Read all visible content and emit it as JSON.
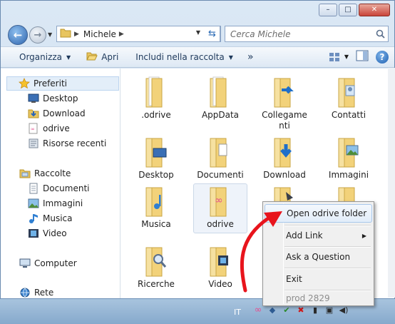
{
  "window": {
    "caption_buttons": {
      "minimize": "–",
      "maximize": "□",
      "close": "✕"
    }
  },
  "address_bar": {
    "breadcrumb": "Michele",
    "search_placeholder": "Cerca Michele"
  },
  "command_bar": {
    "organize": "Organizza",
    "open": "Apri",
    "include_library": "Includi nella raccolta",
    "more": "»"
  },
  "sidebar": {
    "favorites_header": "Preferiti",
    "favorites": [
      "Desktop",
      "Download",
      "odrive",
      "Risorse recenti"
    ],
    "libraries_header": "Raccolte",
    "libraries": [
      "Documenti",
      "Immagini",
      "Musica",
      "Video"
    ],
    "computer": "Computer",
    "network": "Rete"
  },
  "files": [
    {
      "name": ".odrive",
      "icon": "folder-icon"
    },
    {
      "name": "AppData",
      "icon": "folder-icon"
    },
    {
      "name": "Collegamenti",
      "icon": "links-folder-icon"
    },
    {
      "name": "Contatti",
      "icon": "contacts-folder-icon"
    },
    {
      "name": "Desktop",
      "icon": "desktop-folder-icon"
    },
    {
      "name": "Documenti",
      "icon": "documents-folder-icon"
    },
    {
      "name": "Download",
      "icon": "downloads-folder-icon"
    },
    {
      "name": "Immagini",
      "icon": "pictures-folder-icon"
    },
    {
      "name": "Musica",
      "icon": "music-folder-icon"
    },
    {
      "name": "odrive",
      "icon": "odrive-folder-icon"
    },
    {
      "name": "Ricerche",
      "icon": "searches-folder-icon"
    },
    {
      "name": "Video",
      "icon": "videos-folder-icon"
    }
  ],
  "files_display": {
    "collegamenti_line1": "Collegame",
    "collegamenti_line2": "nti"
  },
  "context_menu": {
    "items": [
      "Open odrive folder",
      "Add Link",
      "Ask a Question",
      "Exit",
      "prod 2829"
    ],
    "submenu_arrow": "▶"
  },
  "taskbar": {
    "language": "IT"
  },
  "colors": {
    "accent": "#2e64ad",
    "folder": "#f2d27a",
    "odrive": "#e5508f",
    "arrow": "#e8141c"
  }
}
